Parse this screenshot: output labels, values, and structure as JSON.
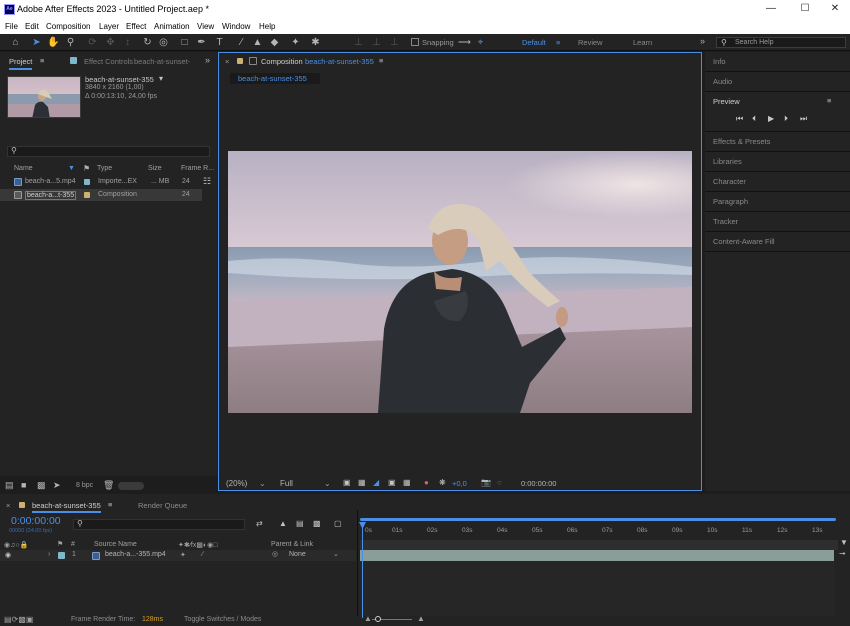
{
  "titlebar": {
    "title": "Adobe After Effects 2023 - Untitled Project.aep *",
    "logo": "Ae"
  },
  "menu": [
    "File",
    "Edit",
    "Composition",
    "Layer",
    "Effect",
    "Animation",
    "View",
    "Window",
    "Help"
  ],
  "toolbar": {
    "snapping_label": "Snapping",
    "workspaces": [
      "Default",
      "Review",
      "Learn"
    ],
    "search_placeholder": "Search Help"
  },
  "project_panel": {
    "tab_project": "Project",
    "tab_effect_controls": "Effect Controls",
    "effect_controls_target": "beach-at-sunset-",
    "preview_name": "beach-at-sunset-355",
    "preview_res": "3840 x 2160 (1,00)",
    "preview_duration": "Δ 0:00:13:10, 24,00 fps",
    "columns": {
      "name": "Name",
      "type": "Type",
      "size": "Size",
      "frame_rate": "Frame R..."
    },
    "items": [
      {
        "name": "beach-a...5.mp4",
        "type": "Importe...EX",
        "size": "... MB",
        "frame_rate": "24",
        "color": "#7fb8c8"
      },
      {
        "name": "beach-a...t-355",
        "type": "Composition",
        "size": "",
        "frame_rate": "24",
        "color": "#d0b070"
      }
    ],
    "bpc": "8 bpc"
  },
  "comp_panel": {
    "tab_prefix": "Composition",
    "tab_name": "beach-at-sunset-355",
    "subtab": "beach-at-sunset-355",
    "zoom": "(20%)",
    "resolution": "Full",
    "exposure": "+0,0",
    "timecode": "0:00:00:00"
  },
  "right_panel": {
    "items": [
      "Info",
      "Audio",
      "Preview",
      "Effects & Presets",
      "Libraries",
      "Character",
      "Paragraph",
      "Tracker",
      "Content-Aware Fill"
    ]
  },
  "timeline": {
    "tab_name": "beach-at-sunset-355",
    "tab_render_queue": "Render Queue",
    "timecode": "0:00:00:00",
    "timecode_sub": "00000 (24.00 fps)",
    "col_source_name": "Source Name",
    "col_parent": "Parent & Link",
    "layer_index": "1",
    "layer_name": "beach-a...-355.mp4",
    "layer_parent": "None",
    "ruler": [
      "0s",
      "01s",
      "02s",
      "03s",
      "04s",
      "05s",
      "06s",
      "07s",
      "08s",
      "09s",
      "10s",
      "11s",
      "12s",
      "13s"
    ],
    "frame_render_label": "Frame Render Time:",
    "frame_render_value": "128ms",
    "toggle_label": "Toggle Switches / Modes"
  },
  "colors": {
    "accent": "#4a8fe7",
    "panel": "#232323",
    "bg": "#1d1d1d",
    "layer_bar": "#8a9e99"
  }
}
